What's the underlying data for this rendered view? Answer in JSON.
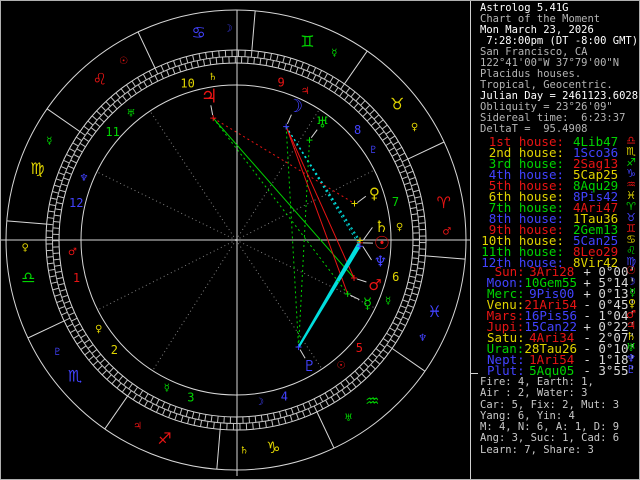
{
  "palette": {
    "red": "#e81414",
    "yellow": "#e0d400",
    "green": "#00d400",
    "blue": "#4242ff",
    "cyan": "#00dede",
    "white": "#ffffff",
    "dim": "#b4b4b4",
    "wheel_line": "#d8d8d8",
    "tick_gray": "#c0c0c0",
    "cusp_dotted": "#808080",
    "pointer": "#d8d8d8"
  },
  "info_panel": {
    "header_lines": [
      {
        "text": "Astrolog 5.41G",
        "tone": "bright"
      },
      {
        "text": "Chart of the Moment",
        "tone": "dim"
      },
      {
        "text": "Mon March 23, 2026",
        "tone": "bright"
      },
      {
        "text": " 7:28:00pm (DT -8:00 GMT)",
        "tone": "bright"
      },
      {
        "text": "San Francisco, CA",
        "tone": "dim"
      },
      {
        "text": "122°41'00\"W 37°79'00\"N",
        "tone": "dim"
      },
      {
        "text": "Placidus houses.",
        "tone": "dim"
      },
      {
        "text": "Tropical, Geocentric.",
        "tone": "dim"
      },
      {
        "text": "Julian Day = 2461123.6028",
        "tone": "bright"
      },
      {
        "text": "Obliquity = 23°26'09\"",
        "tone": "dim"
      },
      {
        "text": "Sidereal time:  6:23:37",
        "tone": "dim"
      },
      {
        "text": "DeltaT =  95.4908",
        "tone": "dim"
      }
    ],
    "houses": [
      {
        "label": "1st house:",
        "value": "4Lib47",
        "sign": "libra",
        "glyph": "♎",
        "label_color": "red",
        "value_color": "green",
        "glyph_color": "red"
      },
      {
        "label": "2nd house:",
        "value": "1Sco36",
        "sign": "scorpio",
        "glyph": "♏",
        "label_color": "yellow",
        "value_color": "blue",
        "glyph_color": "yellow"
      },
      {
        "label": "3rd house:",
        "value": "2Sag13",
        "sign": "sagittarius",
        "glyph": "♐",
        "label_color": "green",
        "value_color": "red",
        "glyph_color": "green"
      },
      {
        "label": "4th house:",
        "value": "5Cap25",
        "sign": "capricorn",
        "glyph": "♑",
        "label_color": "blue",
        "value_color": "yellow",
        "glyph_color": "blue"
      },
      {
        "label": "5th house:",
        "value": "8Aqu29",
        "sign": "aquarius",
        "glyph": "♒",
        "label_color": "red",
        "value_color": "green",
        "glyph_color": "red"
      },
      {
        "label": "6th house:",
        "value": "8Pis42",
        "sign": "pisces",
        "glyph": "♓",
        "label_color": "yellow",
        "value_color": "blue",
        "glyph_color": "yellow"
      },
      {
        "label": "7th house:",
        "value": "4Ari47",
        "sign": "aries",
        "glyph": "♈",
        "label_color": "green",
        "value_color": "red",
        "glyph_color": "green"
      },
      {
        "label": "8th house:",
        "value": "1Tau36",
        "sign": "taurus",
        "glyph": "♉",
        "label_color": "blue",
        "value_color": "yellow",
        "glyph_color": "blue"
      },
      {
        "label": "9th house:",
        "value": "2Gem13",
        "sign": "gemini",
        "glyph": "♊",
        "label_color": "red",
        "value_color": "green",
        "glyph_color": "red"
      },
      {
        "label": "10th house:",
        "value": "5Can25",
        "sign": "cancer",
        "glyph": "♋",
        "label_color": "yellow",
        "value_color": "blue",
        "glyph_color": "yellow"
      },
      {
        "label": "11th house:",
        "value": "8Leo29",
        "sign": "leo",
        "glyph": "♌",
        "label_color": "green",
        "value_color": "red",
        "glyph_color": "green"
      },
      {
        "label": "12th house:",
        "value": "8Vir42",
        "sign": "virgo",
        "glyph": "♍",
        "label_color": "blue",
        "value_color": "yellow",
        "glyph_color": "blue"
      }
    ],
    "planets": [
      {
        "label": "Sun:",
        "name": "sun",
        "value": "3Ari28",
        "latitude": "+ 0°00'",
        "glyph": "☉",
        "planet_color": "red",
        "value_color": "red"
      },
      {
        "label": "Moon:",
        "name": "moon",
        "value": "10Gem55",
        "latitude": "+ 5°14'",
        "glyph": "☽",
        "planet_color": "blue",
        "value_color": "green"
      },
      {
        "label": "Merc:",
        "name": "mercury",
        "value": "9Pis00",
        "latitude": "+ 0°13'",
        "glyph": "☿",
        "planet_color": "green",
        "value_color": "blue"
      },
      {
        "label": "Venu:",
        "name": "venus",
        "value": "21Ari54",
        "latitude": "- 0°45'",
        "glyph": "♀",
        "planet_color": "yellow",
        "value_color": "red"
      },
      {
        "label": "Mars:",
        "name": "mars",
        "value": "16Pis56",
        "latitude": "- 1°04'",
        "glyph": "♂",
        "planet_color": "red",
        "value_color": "blue"
      },
      {
        "label": "Jupi:",
        "name": "jupiter",
        "value": "15Can22",
        "latitude": "+ 0°22'",
        "glyph": "♃",
        "planet_color": "red",
        "value_color": "blue"
      },
      {
        "label": "Satu:",
        "name": "saturn",
        "value": "4Ari34",
        "latitude": "- 2°07'",
        "glyph": "♄",
        "planet_color": "yellow",
        "value_color": "red"
      },
      {
        "label": "Uran:",
        "name": "uranus",
        "value": "28Tau26",
        "latitude": "- 0°10'",
        "glyph": "♅",
        "planet_color": "green",
        "value_color": "yellow"
      },
      {
        "label": "Nept:",
        "name": "neptune",
        "value": "1Ari54",
        "latitude": "- 1°18'",
        "glyph": "♆",
        "planet_color": "blue",
        "value_color": "red"
      },
      {
        "label": "Plut:",
        "name": "pluto",
        "value": "5Aqu05",
        "latitude": "- 3°55'",
        "glyph": "♇",
        "planet_color": "blue",
        "value_color": "green"
      }
    ],
    "summary_lines": [
      "Fire: 4, Earth: 1,",
      "Air : 2, Water: 3",
      "Car: 5, Fix: 2, Mut: 3",
      "Yang: 6, Yin: 4",
      "M: 4, N: 6, A: 1, D: 9",
      "Ang: 3, Suc: 1, Cad: 6",
      "Learn: 7, Share: 3"
    ]
  },
  "wheel": {
    "asc_lon": 184.783,
    "house_cusps": [
      184.783,
      211.6,
      242.217,
      275.417,
      308.483,
      338.7,
      4.783,
      31.6,
      62.217,
      95.417,
      128.483,
      158.7
    ],
    "house_number_colors": [
      "red",
      "yellow",
      "green",
      "blue",
      "red",
      "yellow",
      "green",
      "blue",
      "red",
      "yellow",
      "green",
      "blue"
    ],
    "house_rulers": [
      {
        "glyph": "♂",
        "color": "red"
      },
      {
        "glyph": "♀",
        "color": "yellow"
      },
      {
        "glyph": "☿",
        "color": "green"
      },
      {
        "glyph": "☽",
        "color": "blue"
      },
      {
        "glyph": "☉",
        "color": "red"
      },
      {
        "glyph": "☿",
        "color": "green"
      },
      {
        "glyph": "♀",
        "color": "yellow"
      },
      {
        "glyph": "♇",
        "color": "blue"
      },
      {
        "glyph": "♃",
        "color": "red"
      },
      {
        "glyph": "♄",
        "color": "yellow"
      },
      {
        "glyph": "♅",
        "color": "green"
      },
      {
        "glyph": "♆",
        "color": "blue"
      }
    ],
    "signs": [
      {
        "name": "aries",
        "glyph": "♈",
        "color": "red",
        "ruler_glyph": "♂",
        "ruler_color": "red"
      },
      {
        "name": "taurus",
        "glyph": "♉",
        "color": "yellow",
        "ruler_glyph": "♀",
        "ruler_color": "yellow"
      },
      {
        "name": "gemini",
        "glyph": "♊",
        "color": "green",
        "ruler_glyph": "☿",
        "ruler_color": "green"
      },
      {
        "name": "cancer",
        "glyph": "♋",
        "color": "blue",
        "ruler_glyph": "☽",
        "ruler_color": "blue"
      },
      {
        "name": "leo",
        "glyph": "♌",
        "color": "red",
        "ruler_glyph": "☉",
        "ruler_color": "red"
      },
      {
        "name": "virgo",
        "glyph": "♍",
        "color": "yellow",
        "ruler_glyph": "☿",
        "ruler_color": "green"
      },
      {
        "name": "libra",
        "glyph": "♎",
        "color": "green",
        "ruler_glyph": "♀",
        "ruler_color": "yellow"
      },
      {
        "name": "scorpio",
        "glyph": "♏",
        "color": "blue",
        "ruler_glyph": "♇",
        "ruler_color": "blue"
      },
      {
        "name": "sagittarius",
        "glyph": "♐",
        "color": "red",
        "ruler_glyph": "♃",
        "ruler_color": "red"
      },
      {
        "name": "capricorn",
        "glyph": "♑",
        "color": "yellow",
        "ruler_glyph": "♄",
        "ruler_color": "yellow"
      },
      {
        "name": "aquarius",
        "glyph": "♒",
        "color": "green",
        "ruler_glyph": "♅",
        "ruler_color": "green"
      },
      {
        "name": "pisces",
        "glyph": "♓",
        "color": "blue",
        "ruler_glyph": "♆",
        "ruler_color": "blue"
      }
    ],
    "planets": [
      {
        "name": "sun",
        "glyph": "☉",
        "color": "red",
        "lon": 3.467,
        "fan": 0,
        "size": 18
      },
      {
        "name": "moon",
        "glyph": "☽",
        "color": "blue",
        "lon": 70.917,
        "fan": 0,
        "size": 18
      },
      {
        "name": "mercury",
        "glyph": "☿",
        "color": "green",
        "lon": 339.0,
        "fan": 0,
        "size": 15
      },
      {
        "name": "venus",
        "glyph": "♀",
        "color": "yellow",
        "lon": 21.9,
        "fan": 1.5,
        "size": 15
      },
      {
        "name": "mars",
        "glyph": "♂",
        "color": "red",
        "lon": 346.933,
        "fan": 0,
        "size": 15
      },
      {
        "name": "jupiter",
        "glyph": "♃",
        "color": "red",
        "lon": 105.367,
        "fan": 0,
        "size": 19
      },
      {
        "name": "saturn",
        "glyph": "♄",
        "color": "yellow",
        "lon": 4.567,
        "fan": 5.5,
        "size": 16
      },
      {
        "name": "uranus",
        "glyph": "♅",
        "color": "green",
        "lon": 58.433,
        "fan": 0,
        "size": 15
      },
      {
        "name": "neptune",
        "glyph": "♆",
        "color": "blue",
        "lon": 1.9,
        "fan": -5.5,
        "size": 15
      },
      {
        "name": "pluto",
        "glyph": "♇",
        "color": "blue",
        "lon": 305.083,
        "fan": 0,
        "size": 15
      }
    ],
    "aspects": [
      {
        "a": "jupiter",
        "b": "mars",
        "color": "green",
        "style": "solid"
      },
      {
        "a": "moon",
        "b": "mars",
        "color": "red",
        "style": "solid"
      },
      {
        "a": "moon",
        "b": "mercury",
        "color": "red",
        "style": "solid"
      },
      {
        "a": "pluto",
        "b": "sun",
        "color": "cyan",
        "style": "solid"
      },
      {
        "a": "pluto",
        "b": "saturn",
        "color": "cyan",
        "style": "solid"
      },
      {
        "a": "pluto",
        "b": "neptune",
        "color": "cyan",
        "style": "solid"
      },
      {
        "a": "moon",
        "b": "sun",
        "color": "cyan",
        "style": "dotted"
      },
      {
        "a": "moon",
        "b": "saturn",
        "color": "cyan",
        "style": "dotted"
      },
      {
        "a": "moon",
        "b": "neptune",
        "color": "cyan",
        "style": "dotted"
      },
      {
        "a": "moon",
        "b": "pluto",
        "color": "green",
        "style": "dotted"
      },
      {
        "a": "uranus",
        "b": "pluto",
        "color": "green",
        "style": "dotted"
      },
      {
        "a": "jupiter",
        "b": "mercury",
        "color": "green",
        "style": "dotted"
      },
      {
        "a": "jupiter",
        "b": "venus",
        "color": "red",
        "style": "dotted"
      }
    ]
  }
}
